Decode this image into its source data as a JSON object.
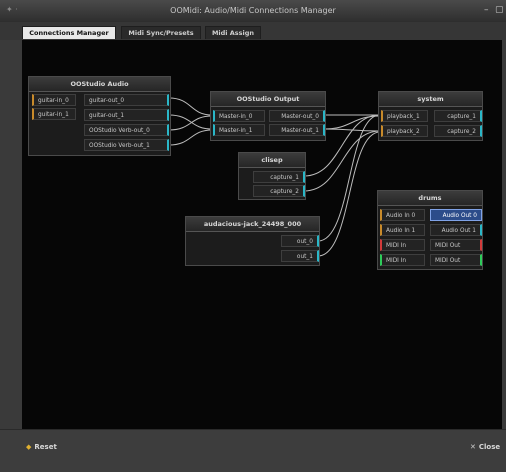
{
  "window": {
    "title": "OOMidi: Audio/Midi Connections Manager",
    "menu_glyph": "✦ ·",
    "min_glyph": "–",
    "max_glyph": "▢"
  },
  "tabs": [
    "Connections Manager",
    "Midi Sync/Presets",
    "Midi Assign"
  ],
  "boxes": {
    "oostudio_audio": {
      "title": "OOStudio Audio",
      "inputs": [
        "guitar-in_0",
        "guitar-in_1"
      ],
      "outputs": [
        "guitar-out_0",
        "guitar-out_1",
        "OOStudio Verb-out_0",
        "OOStudio Verb-out_1"
      ]
    },
    "oostudio_output": {
      "title": "OOStudio Output",
      "inputs": [
        "Master-in_0",
        "Master-in_1"
      ],
      "outputs": [
        "Master-out_0",
        "Master-out_1"
      ]
    },
    "system": {
      "title": "system",
      "inputs": [
        "playback_1",
        "playback_2"
      ],
      "outputs": [
        "capture_1",
        "capture_2"
      ]
    },
    "clisep": {
      "title": "clisep",
      "outputs": [
        "capture_1",
        "capture_2"
      ]
    },
    "audacious": {
      "title": "audacious-jack_24498_000",
      "outputs": [
        "out_0",
        "out_1"
      ]
    },
    "drums": {
      "title": "drums",
      "inputs": [
        "Audio In 0",
        "Audio In 1",
        "MIDI In",
        "MIDI In"
      ],
      "outputs": [
        "Audio Out 0",
        "Audio Out 1",
        "MIDI Out",
        "MIDI Out"
      ]
    }
  },
  "footer": {
    "reset_label": "Reset",
    "close_label": "Close"
  },
  "colors": {
    "audio_in": "#c88a2a",
    "audio_out": "#2ab7c8",
    "midi_out": "#d23a3a",
    "midi_in": "#2ecc5a",
    "wire": "#bcbcbc"
  }
}
